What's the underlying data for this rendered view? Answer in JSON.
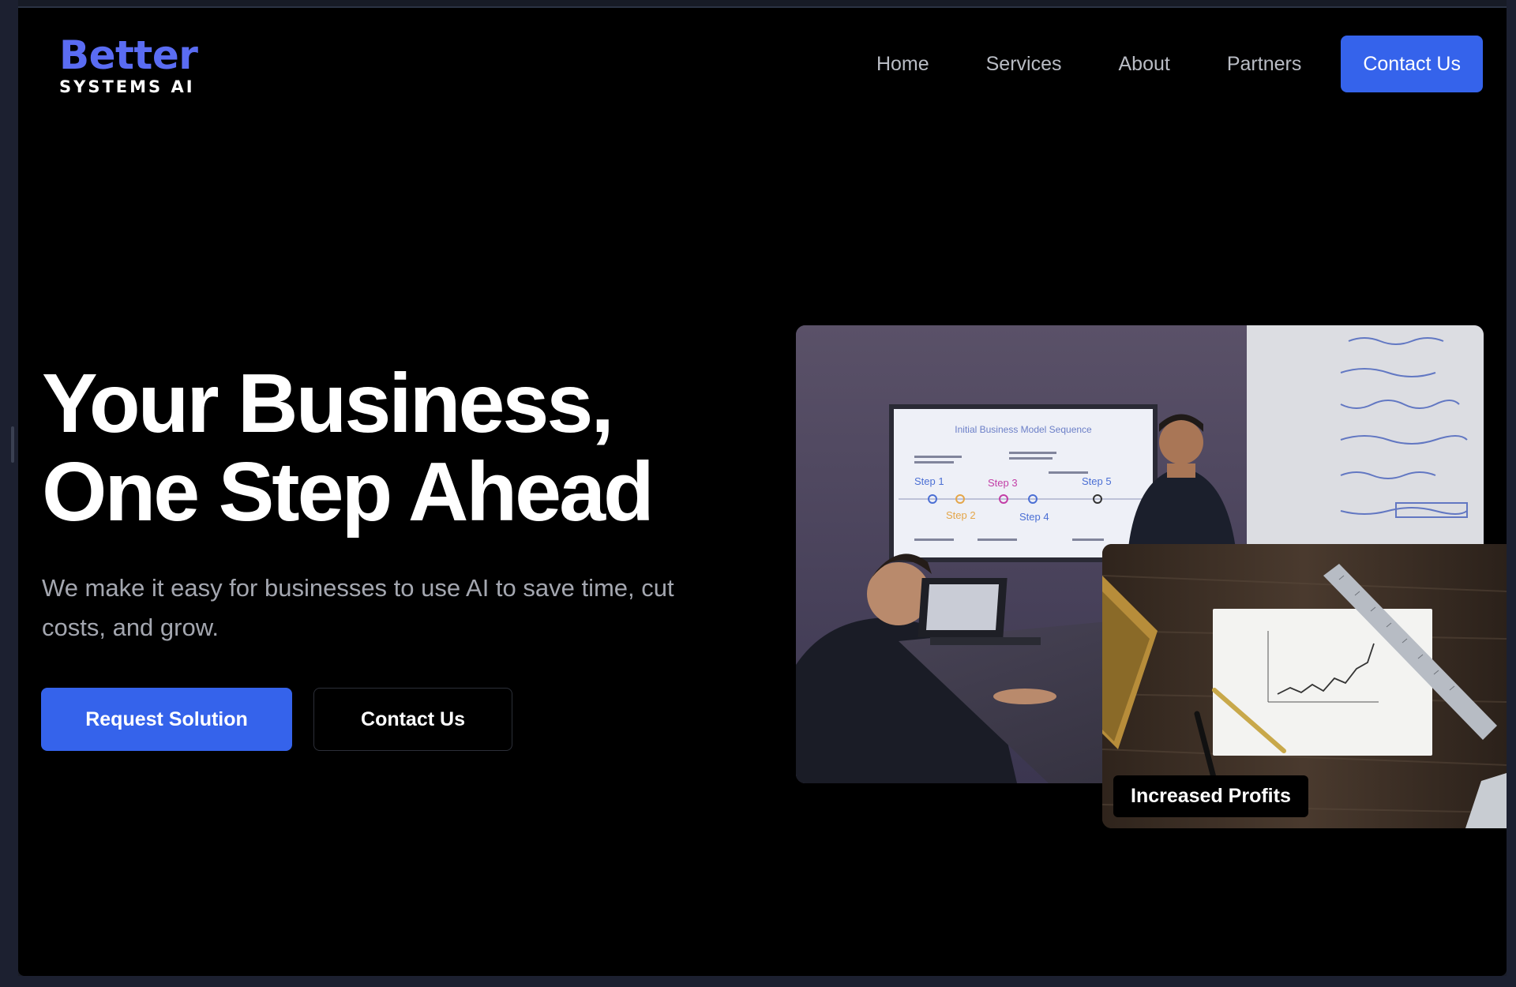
{
  "logo": {
    "line1": "Better",
    "line2": "SYSTEMS AI"
  },
  "nav": {
    "items": [
      {
        "label": "Home"
      },
      {
        "label": "Services"
      },
      {
        "label": "About"
      },
      {
        "label": "Partners"
      }
    ],
    "cta_label": "Contact Us"
  },
  "hero": {
    "title_line1": "Your Business,",
    "title_line2": "One Step Ahead",
    "subtitle": "We make it easy for businesses to use AI to save time, cut costs, and grow.",
    "primary_button": "Request Solution",
    "secondary_button": "Contact Us"
  },
  "images": {
    "main_screen_text": {
      "title": "Initial Business Model Sequence",
      "steps": [
        "Step 1",
        "Step 2",
        "Step 3",
        "Step 4",
        "Step 5"
      ]
    },
    "secondary_badge": "Increased Profits"
  },
  "colors": {
    "accent": "#3563eb",
    "logo_blue": "#5a6cf2",
    "background": "#000000",
    "muted_text": "#a4a7b0"
  }
}
